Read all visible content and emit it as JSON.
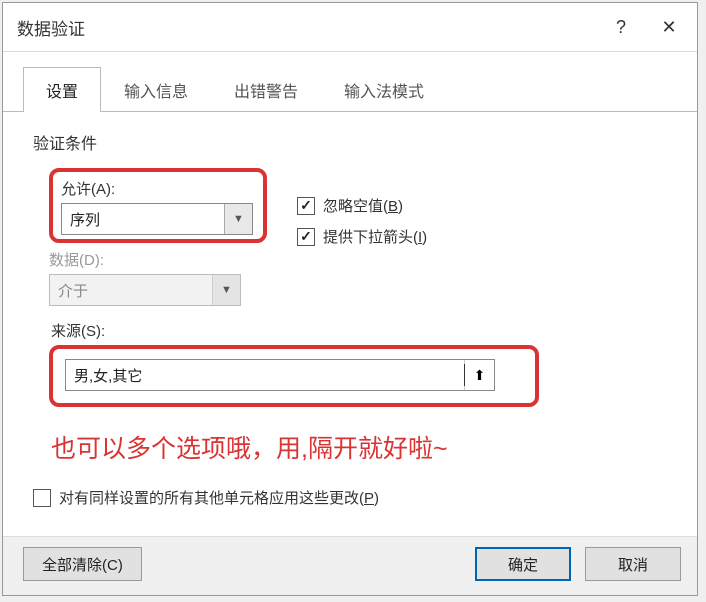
{
  "titlebar": {
    "title": "数据验证"
  },
  "tabs": [
    {
      "label": "设置",
      "active": true
    },
    {
      "label": "输入信息",
      "active": false
    },
    {
      "label": "出错警告",
      "active": false
    },
    {
      "label": "输入法模式",
      "active": false
    }
  ],
  "content": {
    "section_label": "验证条件",
    "allow": {
      "label": "允许(A):",
      "value": "序列"
    },
    "ignore_blank": {
      "label_prefix": "忽略空值(",
      "label_key": "B",
      "label_suffix": ")",
      "checked": true
    },
    "dropdown_arrow": {
      "label_prefix": "提供下拉箭头(",
      "label_key": "I",
      "label_suffix": ")",
      "checked": true
    },
    "data": {
      "label": "数据(D):",
      "value": "介于"
    },
    "source": {
      "label": "来源(S):",
      "value": "男,女,其它"
    },
    "annotation": "也可以多个选项哦，用,隔开就好啦~",
    "apply_all": {
      "label_prefix": "对有同样设置的所有其他单元格应用这些更改(",
      "label_key": "P",
      "label_suffix": ")",
      "checked": false
    }
  },
  "footer": {
    "clear_label": "全部清除(C)",
    "ok_label": "确定",
    "cancel_label": "取消"
  }
}
